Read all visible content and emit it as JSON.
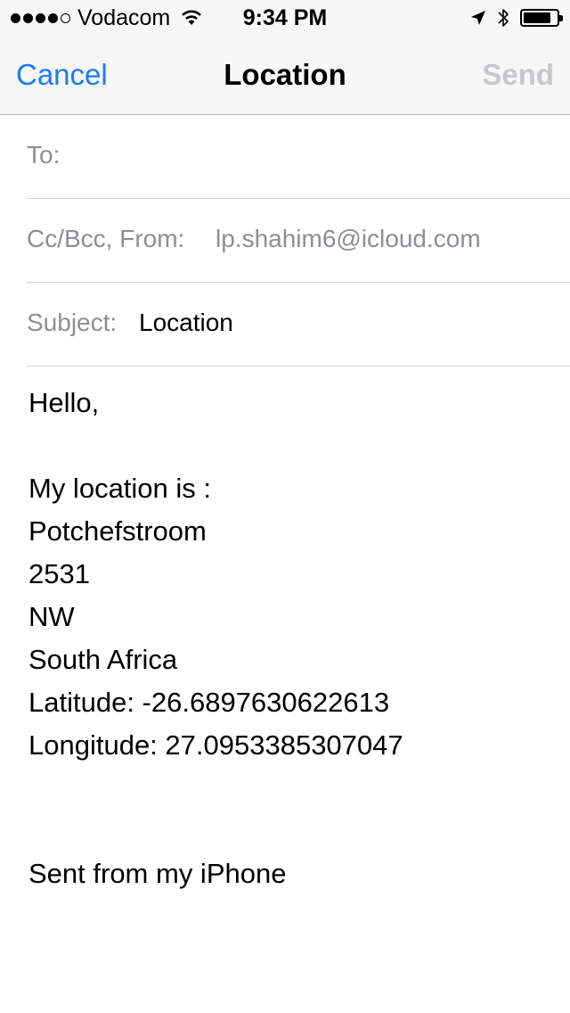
{
  "status_bar": {
    "signal_filled": 4,
    "signal_total": 5,
    "carrier": "Vodacom",
    "time": "9:34 PM",
    "icons": [
      "wifi-icon",
      "location-arrow-icon",
      "bluetooth-icon",
      "battery-icon"
    ],
    "battery_level": 0.8
  },
  "nav": {
    "cancel_label": "Cancel",
    "title": "Location",
    "send_label": "Send",
    "accent_color": "#1a7cf4",
    "disabled_color": "#c7c7cc"
  },
  "fields": {
    "to_label": "To:",
    "to_value": "",
    "from_label": "Cc/Bcc, From:",
    "from_value": "lp.shahim6@icloud.com",
    "subject_label": "Subject:",
    "subject_value": "Location"
  },
  "body": {
    "greeting": "Hello,",
    "intro": "My location is :",
    "city": "Potchefstroom",
    "postal_code": "2531",
    "region": "NW",
    "country": "South Africa",
    "latitude": "Latitude: -26.6897630622613",
    "longitude": "Longitude: 27.0953385307047",
    "signature": "Sent from my iPhone"
  }
}
